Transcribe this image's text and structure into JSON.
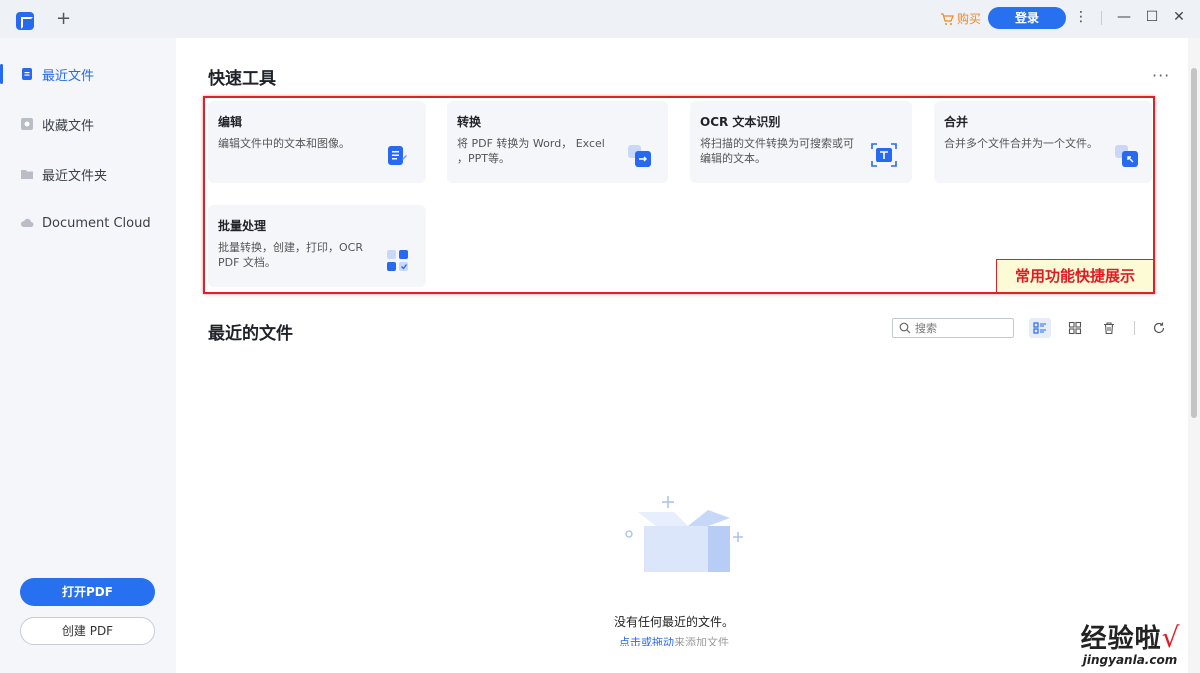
{
  "titlebar": {
    "new_tab_label": "+",
    "buy_label": "购买",
    "login_label": "登录",
    "more_label": "⋮",
    "minimize_label": "—",
    "maximize_label": "☐",
    "close_label": "✕"
  },
  "sidebar": {
    "items": [
      {
        "label": "最近文件",
        "icon": "recent-file-icon",
        "active": true
      },
      {
        "label": "收藏文件",
        "icon": "star-icon",
        "active": false
      },
      {
        "label": "最近文件夹",
        "icon": "folder-icon",
        "active": false
      },
      {
        "label": "Document Cloud",
        "icon": "cloud-icon",
        "active": false
      }
    ],
    "open_pdf_label": "打开PDF",
    "create_pdf_label": "创建 PDF"
  },
  "quick_tools": {
    "title": "快速工具",
    "more_label": "···",
    "cards": [
      {
        "title": "编辑",
        "desc": "编辑文件中的文本和图像。",
        "icon": "edit-doc-icon"
      },
      {
        "title": "转换",
        "desc": "将 PDF 转换为 Word， Excel ，PPT等。",
        "icon": "convert-icon"
      },
      {
        "title": "OCR 文本识别",
        "desc": "将扫描的文件转换为可搜索或可编辑的文本。",
        "icon": "ocr-scan-icon"
      },
      {
        "title": "合并",
        "desc": "合并多个文件合并为一个文件。",
        "icon": "merge-icon"
      },
      {
        "title": "批量处理",
        "desc": "批量转换，创建，打印，OCR PDF 文档。",
        "icon": "batch-icon"
      }
    ],
    "annotation": "常用功能快捷展示"
  },
  "recent": {
    "title": "最近的文件",
    "search_placeholder": "搜索",
    "empty_text": "没有任何最近的文件。",
    "empty_sub_link": "点击或拖动",
    "empty_sub_rest": "来添加文件"
  },
  "watermark": {
    "cn": "经验啦",
    "check": "√",
    "url": "jingyanla.com"
  },
  "colors": {
    "accent": "#2769f0",
    "annotation_red": "#d9232b",
    "buy_orange": "#f08a24"
  }
}
